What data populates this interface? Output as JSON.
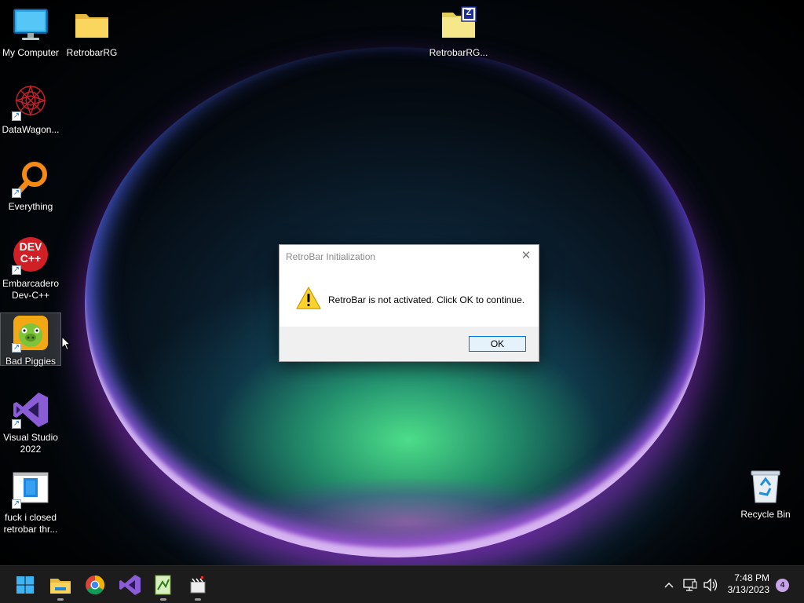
{
  "desktop": {
    "icons": [
      {
        "label_line1": "My Computer",
        "label_line2": "",
        "icon": "monitor-icon"
      },
      {
        "label_line1": "RetrobarRG",
        "label_line2": "",
        "icon": "folder-icon"
      },
      {
        "label_line1": "RetrobarRG...",
        "label_line2": "",
        "icon": "zip-folder-icon"
      },
      {
        "label_line1": "DataWagon...",
        "label_line2": "",
        "icon": "datawagon-icon"
      },
      {
        "label_line1": "Everything",
        "label_line2": "",
        "icon": "magnifier-icon"
      },
      {
        "label_line1": "Embarcadero",
        "label_line2": "Dev-C++",
        "icon": "devcpp-icon"
      },
      {
        "label_line1": "Bad Piggies",
        "label_line2": "",
        "icon": "bad-piggies-icon"
      },
      {
        "label_line1": "Visual Studio",
        "label_line2": "2022",
        "icon": "visual-studio-icon"
      },
      {
        "label_line1": "fuck i closed",
        "label_line2": "retrobar thr...",
        "icon": "document-icon"
      },
      {
        "label_line1": "Recycle Bin",
        "label_line2": "",
        "icon": "recycle-bin-icon"
      }
    ],
    "zip_badge": "Z",
    "devcpp_badge_top": "DEV",
    "devcpp_badge_bottom": "C++"
  },
  "dialog": {
    "title": "RetroBar Initialization",
    "close_glyph": "✕",
    "message": "RetroBar is not activated. Click OK to continue.",
    "ok_label": "OK"
  },
  "taskbar": {
    "apps": [
      "start-button",
      "file-explorer",
      "chrome",
      "visual-studio",
      "notepad-plus-plus",
      "clapperboard-app"
    ],
    "tray_chevron": "^",
    "time": "7:48 PM",
    "date": "3/13/2023",
    "notification_count": "4"
  },
  "colors": {
    "accent": "#0078d7",
    "taskbar_bg": "#1c1c1c",
    "dialog_footer": "#f0f0f0"
  }
}
